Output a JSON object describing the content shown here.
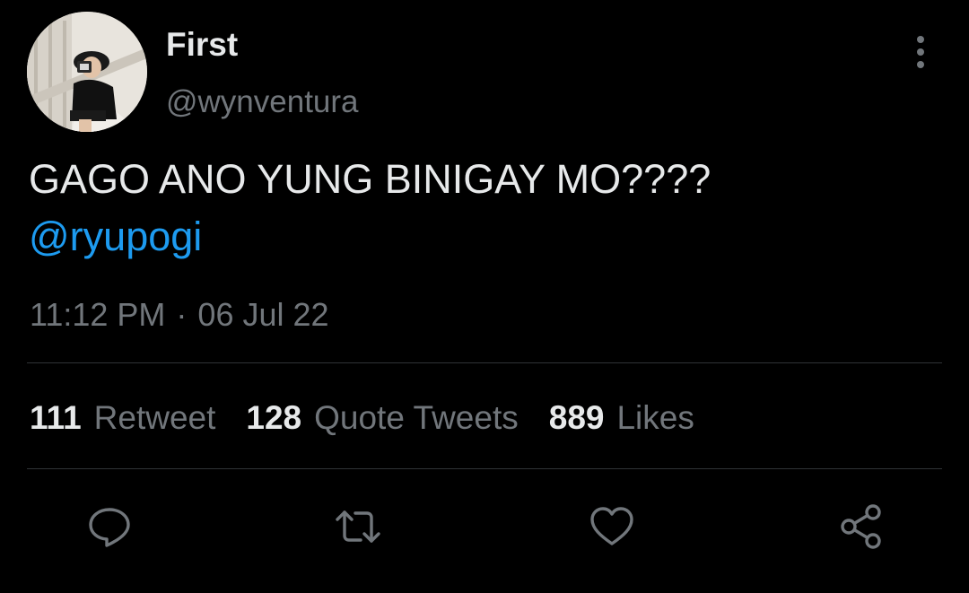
{
  "tweet": {
    "display_name": "First",
    "handle": "@wynventura",
    "text": "GAGO ANO YUNG BINIGAY MO????",
    "mention": "@ryupogi",
    "time": "11:12 PM",
    "separator": "·",
    "date": "06 Jul 22"
  },
  "stats": [
    {
      "count": "111",
      "label": "Retweet"
    },
    {
      "count": "128",
      "label": "Quote Tweets"
    },
    {
      "count": "889",
      "label": "Likes"
    }
  ],
  "actions": [
    "reply-icon",
    "retweet-icon",
    "like-icon",
    "share-icon"
  ],
  "colors": {
    "background": "#000000",
    "text_primary": "#e7e9ea",
    "text_secondary": "#71767b",
    "link": "#1d9bf0",
    "divider": "#2f3336"
  }
}
